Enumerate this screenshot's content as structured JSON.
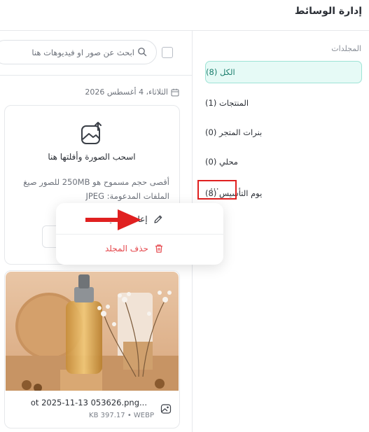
{
  "header": {
    "title": "إدارة الوسائط"
  },
  "sidebar": {
    "heading": "المجلدات",
    "folders": [
      {
        "label": "الكل (8)",
        "active": true
      },
      {
        "label": "المنتجات (1)"
      },
      {
        "label": "بنرات المتجر (0)"
      },
      {
        "label": "محلي (0)"
      },
      {
        "label": "يوم التأسيس (8)"
      }
    ],
    "more_icon": "⋯"
  },
  "toolbar": {
    "search_placeholder": "ابحث عن صور او فيديوهات هنا",
    "search_value": ""
  },
  "date_group": {
    "label": "الثلاثاء، 4 أغسطس 2026"
  },
  "upload": {
    "title": "اسحب الصورة وأفلتها هنا",
    "description": "أقصى حجم مسموح هو 250MB للصور صيغ الملفات المدعومة: JPEG"
  },
  "context_menu": {
    "rename": "إعادة تسمية",
    "delete": "حذف المجلد"
  },
  "media": [
    {
      "file_name": "ot 2025-11-13 053626.png...",
      "meta": "KB 397.17 • WEBP"
    }
  ],
  "colors": {
    "accent": "#1b7e6d",
    "accent_bg": "#e6faf6",
    "danger": "#e5484d",
    "annotation_red": "#e02020"
  }
}
